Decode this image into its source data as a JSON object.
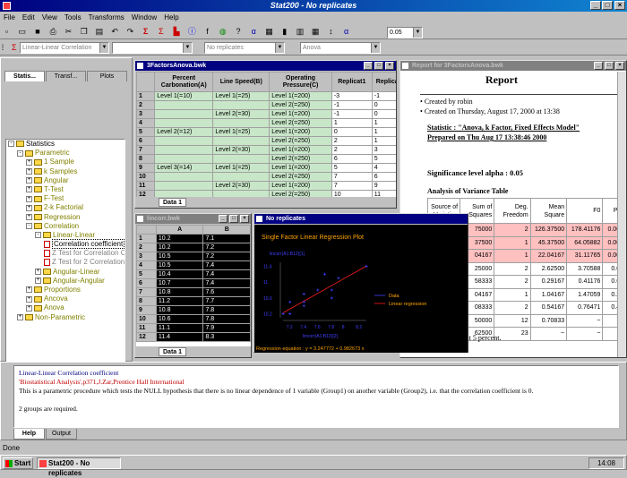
{
  "app": {
    "title": "Stat200 - No replicates",
    "menu": [
      "File",
      "Edit",
      "View",
      "Tools",
      "Transforms",
      "Window",
      "Help"
    ],
    "combo_analysis": "Linear-Linear Correlation",
    "combo_replicates": "No replicates",
    "combo_anova": "Anova",
    "alpha_value": "0.05"
  },
  "left_panel": {
    "tabs": [
      "Statis...",
      "Transf...",
      "Plots"
    ],
    "tree": [
      {
        "label": "Statistics",
        "level": 0,
        "kind": "folder",
        "sign": "-"
      },
      {
        "label": "Parametric",
        "level": 1,
        "kind": "folder",
        "sign": "-"
      },
      {
        "label": "1 Sample",
        "level": 2,
        "kind": "folder",
        "sign": "+"
      },
      {
        "label": "k Samples",
        "level": 2,
        "kind": "folder",
        "sign": "+"
      },
      {
        "label": "Angular",
        "level": 2,
        "kind": "folder",
        "sign": "+"
      },
      {
        "label": "T-Test",
        "level": 2,
        "kind": "folder",
        "sign": "+"
      },
      {
        "label": "F-Test",
        "level": 2,
        "kind": "folder",
        "sign": "+"
      },
      {
        "label": "2-k Factorial",
        "level": 2,
        "kind": "folder",
        "sign": "+"
      },
      {
        "label": "Regression",
        "level": 2,
        "kind": "folder",
        "sign": "+"
      },
      {
        "label": "Correlation",
        "level": 2,
        "kind": "folder",
        "sign": "-"
      },
      {
        "label": "Linear-Linear",
        "level": 3,
        "kind": "folder",
        "sign": "-"
      },
      {
        "label": "Correlation coefficient",
        "level": 4,
        "kind": "leaf",
        "selected": true
      },
      {
        "label": "Z Test for Correlation Co...",
        "level": 4,
        "kind": "leaf"
      },
      {
        "label": "Z Test for 2 Correlation C...",
        "level": 4,
        "kind": "leaf"
      },
      {
        "label": "Angular-Linear",
        "level": 3,
        "kind": "folder",
        "sign": "+"
      },
      {
        "label": "Angular-Angular",
        "level": 3,
        "kind": "folder",
        "sign": "+"
      },
      {
        "label": "Proportions",
        "level": 2,
        "kind": "folder",
        "sign": "+"
      },
      {
        "label": "Ancova",
        "level": 2,
        "kind": "folder",
        "sign": "+"
      },
      {
        "label": "Anova",
        "level": 2,
        "kind": "folder",
        "sign": "+"
      },
      {
        "label": "Non-Parametric",
        "level": 1,
        "kind": "folder",
        "sign": "+"
      }
    ]
  },
  "anova_window": {
    "title": "3FactorsAnova.bwk",
    "sheet_tab": "Data 1",
    "headers": [
      "",
      "Percent Carbonation(A)",
      "Line Speed(B)",
      "Operating Pressure(C)",
      "Replicat1",
      "Replicat"
    ],
    "rows": [
      [
        "1",
        "Level 1(=10)",
        "Level 1(=25)",
        "Level 1(=200)",
        "-3",
        "-1"
      ],
      [
        "2",
        "",
        "",
        "Level 2(=250)",
        "-1",
        "0"
      ],
      [
        "3",
        "",
        "Level 2(=30)",
        "Level 1(=200)",
        "-1",
        "0"
      ],
      [
        "4",
        "",
        "",
        "Level 2(=250)",
        "1",
        "1"
      ],
      [
        "5",
        "Level 2(=12)",
        "Level 1(=25)",
        "Level 1(=200)",
        "0",
        "1"
      ],
      [
        "6",
        "",
        "",
        "Level 2(=250)",
        "2",
        "1"
      ],
      [
        "7",
        "",
        "Level 2(=30)",
        "Level 1(=200)",
        "2",
        "3"
      ],
      [
        "8",
        "",
        "",
        "Level 2(=250)",
        "6",
        "5"
      ],
      [
        "9",
        "Level 3(=14)",
        "Level 1(=25)",
        "Level 1(=200)",
        "5",
        "4"
      ],
      [
        "10",
        "",
        "",
        "Level 2(=250)",
        "7",
        "6"
      ],
      [
        "11",
        "",
        "Level 2(=30)",
        "Level 1(=200)",
        "7",
        "9"
      ],
      [
        "12",
        "",
        "",
        "Level 2(=250)",
        "10",
        "11"
      ]
    ]
  },
  "lincorr_window": {
    "title": "lincorr.bwk",
    "sheet_tab": "Data 1",
    "headers": [
      "",
      "A",
      "B"
    ],
    "rows": [
      [
        "1",
        "10.2",
        "7.1"
      ],
      [
        "2",
        "10.2",
        "7.2"
      ],
      [
        "3",
        "10.5",
        "7.2"
      ],
      [
        "4",
        "10.5",
        "7.4"
      ],
      [
        "5",
        "10.4",
        "7.4"
      ],
      [
        "6",
        "10.7",
        "7.4"
      ],
      [
        "7",
        "10.8",
        "7.6"
      ],
      [
        "8",
        "11.2",
        "7.7"
      ],
      [
        "9",
        "10.8",
        "7.8"
      ],
      [
        "10",
        "10.6",
        "7.8"
      ],
      [
        "11",
        "11.1",
        "7.9"
      ],
      [
        "12",
        "11.4",
        "8.3"
      ]
    ]
  },
  "plot_window": {
    "title": "No replicates"
  },
  "chart_data": {
    "type": "scatter",
    "title": "Single Factor Linear Regression Plot",
    "ylabel": "lincorr(A1:B12)[1]",
    "xlabel": "lincorr(A1:B12)[2]",
    "x_ticks": [
      "7.2",
      "7.4",
      "7.6",
      "7.8",
      "8",
      "8.2"
    ],
    "y_ticks": [
      "11.4",
      "11",
      "10.6",
      "10.2"
    ],
    "xlim": [
      7.1,
      8.3
    ],
    "ylim": [
      10.1,
      11.5
    ],
    "points": [
      [
        7.1,
        10.2
      ],
      [
        7.2,
        10.2
      ],
      [
        7.2,
        10.5
      ],
      [
        7.4,
        10.5
      ],
      [
        7.4,
        10.4
      ],
      [
        7.4,
        10.7
      ],
      [
        7.6,
        10.8
      ],
      [
        7.7,
        11.2
      ],
      [
        7.8,
        10.8
      ],
      [
        7.8,
        10.6
      ],
      [
        7.9,
        11.1
      ],
      [
        8.3,
        11.4
      ]
    ],
    "line": {
      "intercept": 3.247772,
      "slope": 0.982673
    },
    "legend": [
      "Data",
      "Linear regression"
    ],
    "legend_position": "right",
    "equation": "Regression equation : y = 3.247772 + 0.982673 x",
    "colors": {
      "bg": "#000000",
      "title": "#ffa500",
      "points": "#4040ff",
      "line": "#ff2020",
      "axes": "#808080"
    }
  },
  "report_window": {
    "title": "Report for 3FactorsAnova.bwk",
    "heading": "Report",
    "created_by": "Created by robin",
    "created_on": "Created on Thursday, August 17, 2000 at 13:38",
    "statistic_line1": "Statistic : \"Anova, k Factor, Fixed Effects Model\"",
    "statistic_line2": "Prepared on Thu Aug 17 13:38:46 2000",
    "alpha": "Significance level alpha : 0.05",
    "table_title": "Analysis of Variance Table",
    "headers": [
      "Source of Variation",
      "Sum of Squares",
      "Deg. Freedom",
      "Mean Square",
      "F0",
      "P(>"
    ],
    "rows": [
      {
        "cells": [
          "",
          "75000",
          "2",
          "126.37500",
          "178.41176",
          "0.000"
        ],
        "highlight": true
      },
      {
        "cells": [
          "",
          "37500",
          "1",
          "45.37500",
          "64.05882",
          "0.000"
        ],
        "highlight": true
      },
      {
        "cells": [
          "",
          "04167",
          "1",
          "22.04167",
          "31.11765",
          "0.000"
        ],
        "highlight": true
      },
      {
        "cells": [
          "",
          "25000",
          "2",
          "2.62500",
          "3.70588",
          "0.05"
        ],
        "highlight": false
      },
      {
        "cells": [
          "",
          "58333",
          "2",
          "0.29167",
          "0.41176",
          "0.67"
        ],
        "highlight": false
      },
      {
        "cells": [
          "",
          "04167",
          "1",
          "1.04167",
          "1.47059",
          "0.24"
        ],
        "highlight": false
      },
      {
        "cells": [
          "",
          "08333",
          "2",
          "0.54167",
          "0.76471",
          "0.48"
        ],
        "highlight": false
      },
      {
        "cells": [
          "",
          "50000",
          "12",
          "0.70833",
          "~",
          "~"
        ],
        "highlight": false
      },
      {
        "cells": [
          "",
          "62500",
          "23",
          "~",
          "~",
          "~"
        ],
        "highlight": false
      }
    ],
    "footnote": "* Significant at 5 percent."
  },
  "help_panel": {
    "line1": "Linear-Linear Correlation coefficient",
    "line2": "'Biostatistical Analysis',p371,J.Zar,Prentice Hall International",
    "line3": "This is a parametric procedure which tests the NULL hypothesis that there is no linear dependence of 1 variable (Group1) on another variable (Group2), i.e. that the correlation coefficient is 0.",
    "line4": "2 groups are required.",
    "tabs": [
      "Help",
      "Output"
    ]
  },
  "status": {
    "text": "Done"
  },
  "taskbar": {
    "start": "Start",
    "task": "Stat200 - No replicates",
    "clock": "14:08"
  }
}
